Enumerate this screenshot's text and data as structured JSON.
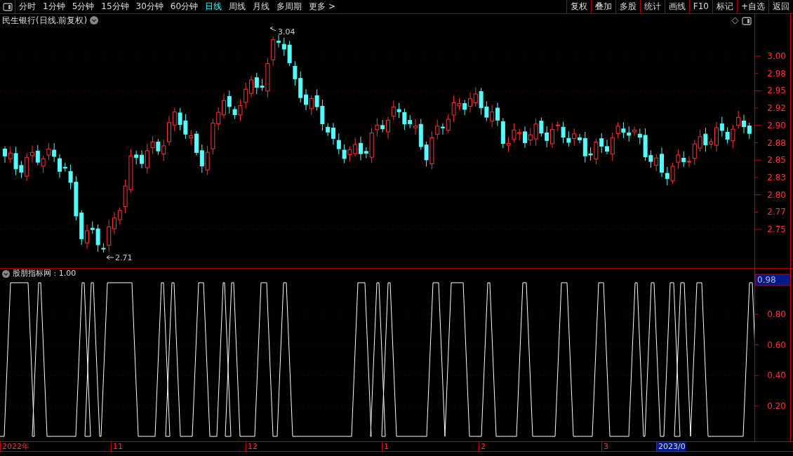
{
  "toolbar": {
    "periods": [
      {
        "label": "分时",
        "selected": false
      },
      {
        "label": "1分钟",
        "selected": false
      },
      {
        "label": "5分钟",
        "selected": false
      },
      {
        "label": "15分钟",
        "selected": false
      },
      {
        "label": "30分钟",
        "selected": false
      },
      {
        "label": "60分钟",
        "selected": false
      },
      {
        "label": "日线",
        "selected": true
      },
      {
        "label": "周线",
        "selected": false
      },
      {
        "label": "月线",
        "selected": false
      },
      {
        "label": "多周期",
        "selected": false
      },
      {
        "label": "更多 >",
        "selected": false
      }
    ],
    "actions": [
      "复权",
      "叠加",
      "多股",
      "统计",
      "画线",
      "F10",
      "标记",
      "+自选",
      "返回"
    ]
  },
  "price_panel": {
    "title": "民生银行(日线.前复权)",
    "high_label": "3.04",
    "low_label": "2.71",
    "axis_labels": [
      "3.00",
      "2.98",
      "2.95",
      "2.92",
      "2.90",
      "2.88",
      "2.85",
      "2.83",
      "2.80",
      "2.77",
      "2.75"
    ]
  },
  "indicator_panel": {
    "title": "股朋指标网 : 1.00",
    "current_value": "0.98",
    "axis_labels": [
      "0.80",
      "0.60",
      "0.40",
      "0.20"
    ]
  },
  "date_axis": [
    {
      "label": "2022年",
      "highlighted": false
    },
    {
      "label": "11",
      "highlighted": false
    },
    {
      "label": "12",
      "highlighted": false
    },
    {
      "label": "1",
      "highlighted": false
    },
    {
      "label": "2",
      "highlighted": false
    },
    {
      "label": "3",
      "highlighted": false
    },
    {
      "label": "2023/0",
      "highlighted": true
    }
  ]
}
